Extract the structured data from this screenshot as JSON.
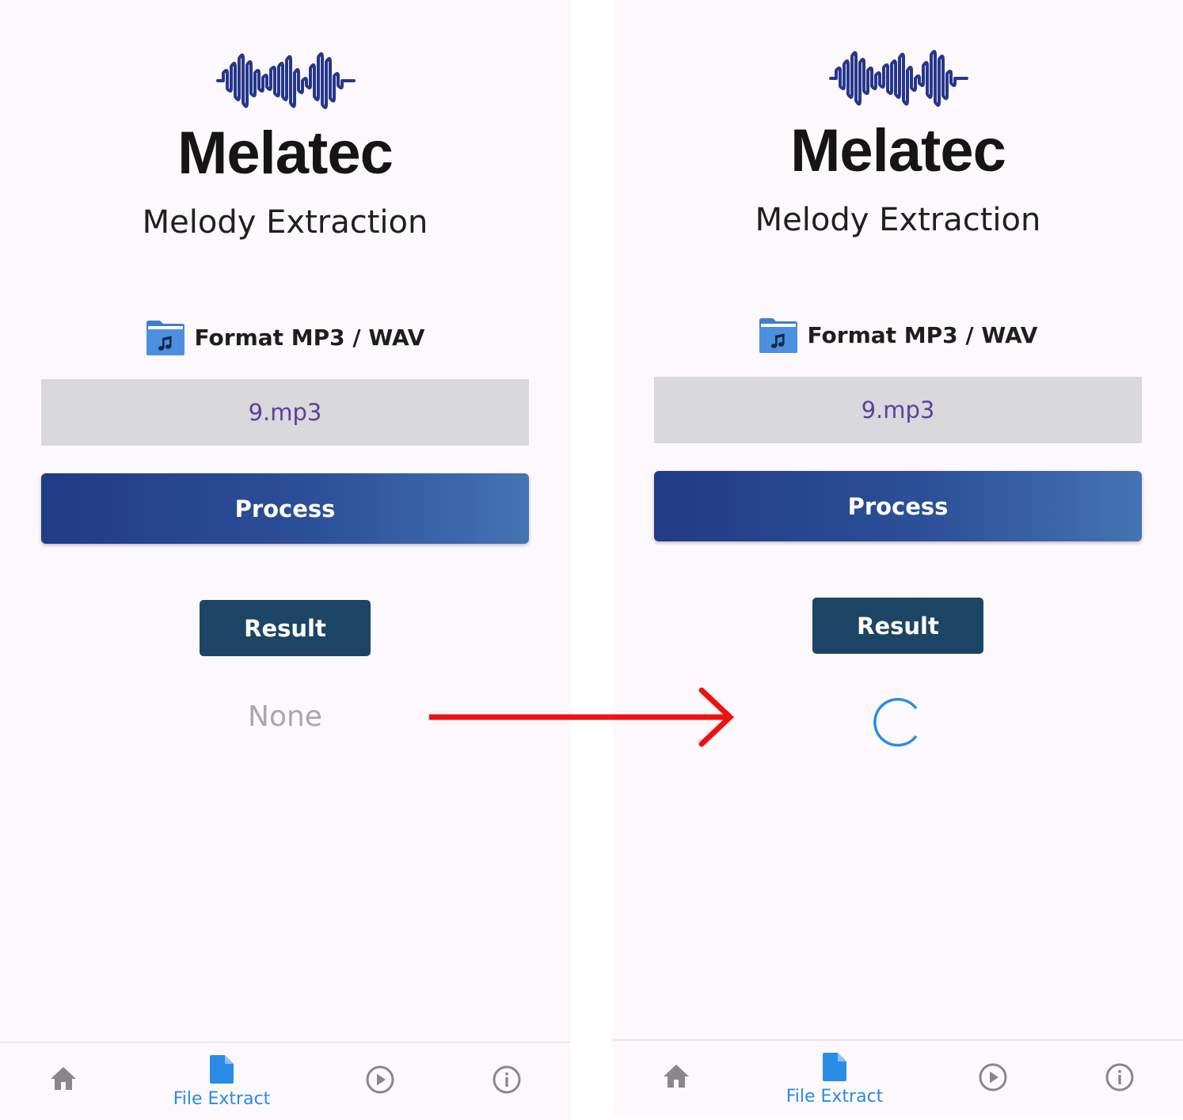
{
  "screens": [
    {
      "app_title": "Melatec",
      "app_subtitle": "Melody Extraction",
      "format_label": "Format MP3 / WAV",
      "file_name": "9.mp3",
      "process_label": "Process",
      "result_label": "Result",
      "result_value": "None",
      "nav": {
        "home": "",
        "file_extract": "File Extract",
        "play": "",
        "info": ""
      }
    },
    {
      "app_title": "Melatec",
      "app_subtitle": "Melody Extraction",
      "format_label": "Format MP3 / WAV",
      "file_name": "9.mp3",
      "process_label": "Process",
      "result_label": "Result",
      "result_state": "loading",
      "nav": {
        "home": "",
        "file_extract": "File Extract",
        "play": "",
        "info": ""
      }
    }
  ],
  "nav_active": "file_extract",
  "icons": {
    "logo": "sound-wave-icon",
    "format": "music-folder-icon",
    "nav_home": "home-icon",
    "nav_file": "file-icon",
    "nav_play": "play-circle-icon",
    "nav_info": "info-icon",
    "loading": "loading-spinner-icon",
    "transition": "red-arrow-icon"
  },
  "colors": {
    "background": "#fdf8fc",
    "brand_navy": "#223b86",
    "brand_blue": "#4474b4",
    "result_button": "#1c4565",
    "file_name_text": "#5b3f9e",
    "nav_active": "#2a8ce6",
    "nav_inactive": "#8a868c",
    "arrow": "#ee1111"
  }
}
